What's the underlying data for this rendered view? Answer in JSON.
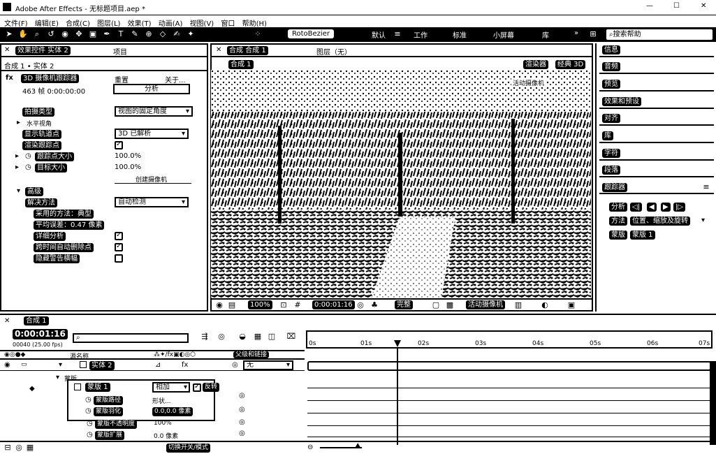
{
  "window": {
    "title": "Adobe After Effects - 无标题项目.aep *",
    "controls": [
      "—",
      "☐",
      "✕"
    ]
  },
  "menu": [
    "文件(F)",
    "编辑(E)",
    "合成(C)",
    "图层(L)",
    "效果(T)",
    "动画(A)",
    "视图(V)",
    "窗口",
    "帮助(H)"
  ],
  "toolbar": {
    "rotobezier": "RotoBezier",
    "ws": [
      "默认",
      "工作",
      "标准",
      "小屏幕",
      "库"
    ],
    "search_placeholder": "搜索帮助"
  },
  "effects_panel": {
    "tab": "效果控件 实体 2",
    "tab2": "项目",
    "breadcrumb": "合成 1 • 实体 2",
    "effect_name": "3D 摄像机跟踪器",
    "reset": "重置",
    "about": "关于...",
    "frame_info": "463 帧 0:00:00:00",
    "analyze": "分析",
    "rows": [
      {
        "label": "拍摄类型",
        "value": "视图的固定角度"
      },
      {
        "label": "水平视角",
        "value": ""
      },
      {
        "label": "显示轨道点",
        "value": "3D 已解析"
      },
      {
        "label": "渲染跟踪点",
        "value": ""
      },
      {
        "label": "跟踪点大小",
        "value": "100.0%"
      },
      {
        "label": "目标大小",
        "value": "100.0%"
      },
      {
        "label": "",
        "value": "创建摄像机"
      },
      {
        "label": "高级",
        "value": ""
      },
      {
        "label": "解决方法",
        "value": "自动检测"
      },
      {
        "label": "采用的方法",
        "value": "典型"
      },
      {
        "label": "平均误差",
        "value": "0.47 像素"
      },
      {
        "label": "详细分析",
        "value": ""
      },
      {
        "label": "跨时间自动删除点",
        "value": ""
      },
      {
        "label": "隐藏警告横幅",
        "value": ""
      }
    ]
  },
  "comp_panel": {
    "tab": "合成 合成 1",
    "layer_tab": "图层（无）",
    "subtab": "合成 1",
    "renderer": "渲染器",
    "renderer_value": "经典 3D",
    "active_cam": "活动摄像机",
    "footer": {
      "zoom": "100%",
      "time": "0:00:01:16",
      "quality": "完整",
      "cam": "活动摄像机"
    }
  },
  "right_panels": [
    "信息",
    "音频",
    "预览",
    "效果和预设",
    "对齐",
    "库",
    "字符",
    "段落"
  ],
  "tracker": {
    "title": "跟踪器",
    "analyze": "分析",
    "method_label": "方法",
    "method_value": "位置、缩放及旋转",
    "mask_label": "蒙版",
    "mask_value": "蒙版 1"
  },
  "timeline": {
    "tab": "合成 1",
    "time": "0:00:01:16",
    "frames": "00040 (25.00 fps)",
    "col_source": "源名称",
    "col_parent": "父级和链接",
    "layer_name": "实体 2",
    "parent_value": "无",
    "masks_group": "蒙版",
    "mask_name": "蒙版 1",
    "mask_mode": "相加",
    "mask_invert": "反转",
    "mask_props": [
      {
        "label": "蒙版路径",
        "value": "形状..."
      },
      {
        "label": "蒙版羽化",
        "value": "0.0,0.0 像素"
      },
      {
        "label": "蒙版不透明度",
        "value": "100%"
      },
      {
        "label": "蒙版扩展",
        "value": "0.0 像素"
      }
    ],
    "ruler": [
      "0s",
      "01s",
      "02s",
      "03s",
      "04s",
      "05s",
      "06s",
      "07s"
    ],
    "footer": "切换开关/模式"
  }
}
